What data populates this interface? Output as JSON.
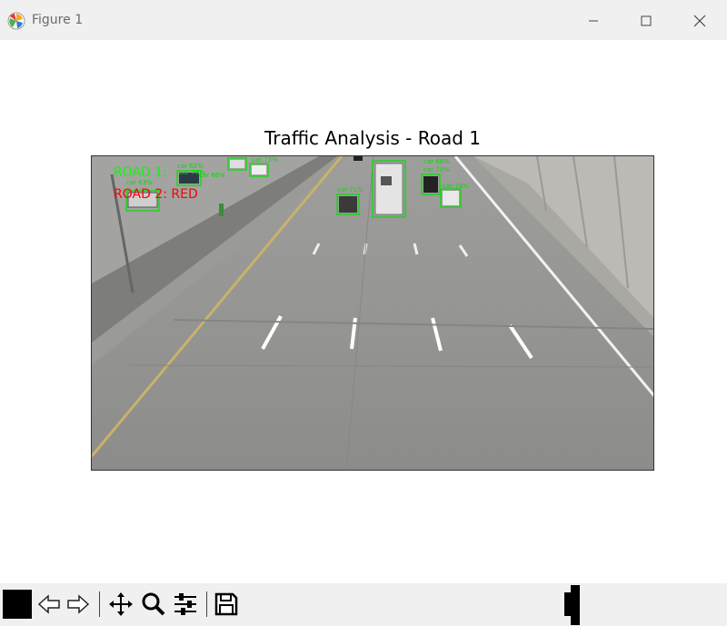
{
  "window": {
    "title": "Figure 1",
    "icon": "matplotlib-icon",
    "controls": [
      "minimize-icon",
      "maximize-icon",
      "close-icon"
    ]
  },
  "figure": {
    "title": "Traffic Analysis - Road 1"
  },
  "video_overlay": {
    "road1_label": "ROAD 1:",
    "road2_label": "ROAD 2: RED",
    "road1_color": "#00ff00",
    "road2_color": "#ff0000",
    "detection_color": "#00e000",
    "detections": [
      "car 63%",
      "car 62%",
      "car 73%",
      "car 71%",
      "car 66%",
      "car 70%",
      "car 74%",
      "car 76%",
      "car 66%"
    ]
  },
  "toolbar": {
    "buttons": [
      "home-icon",
      "back-icon",
      "forward-icon",
      "pan-icon",
      "zoom-icon",
      "configure-subplots-icon",
      "save-icon"
    ]
  }
}
